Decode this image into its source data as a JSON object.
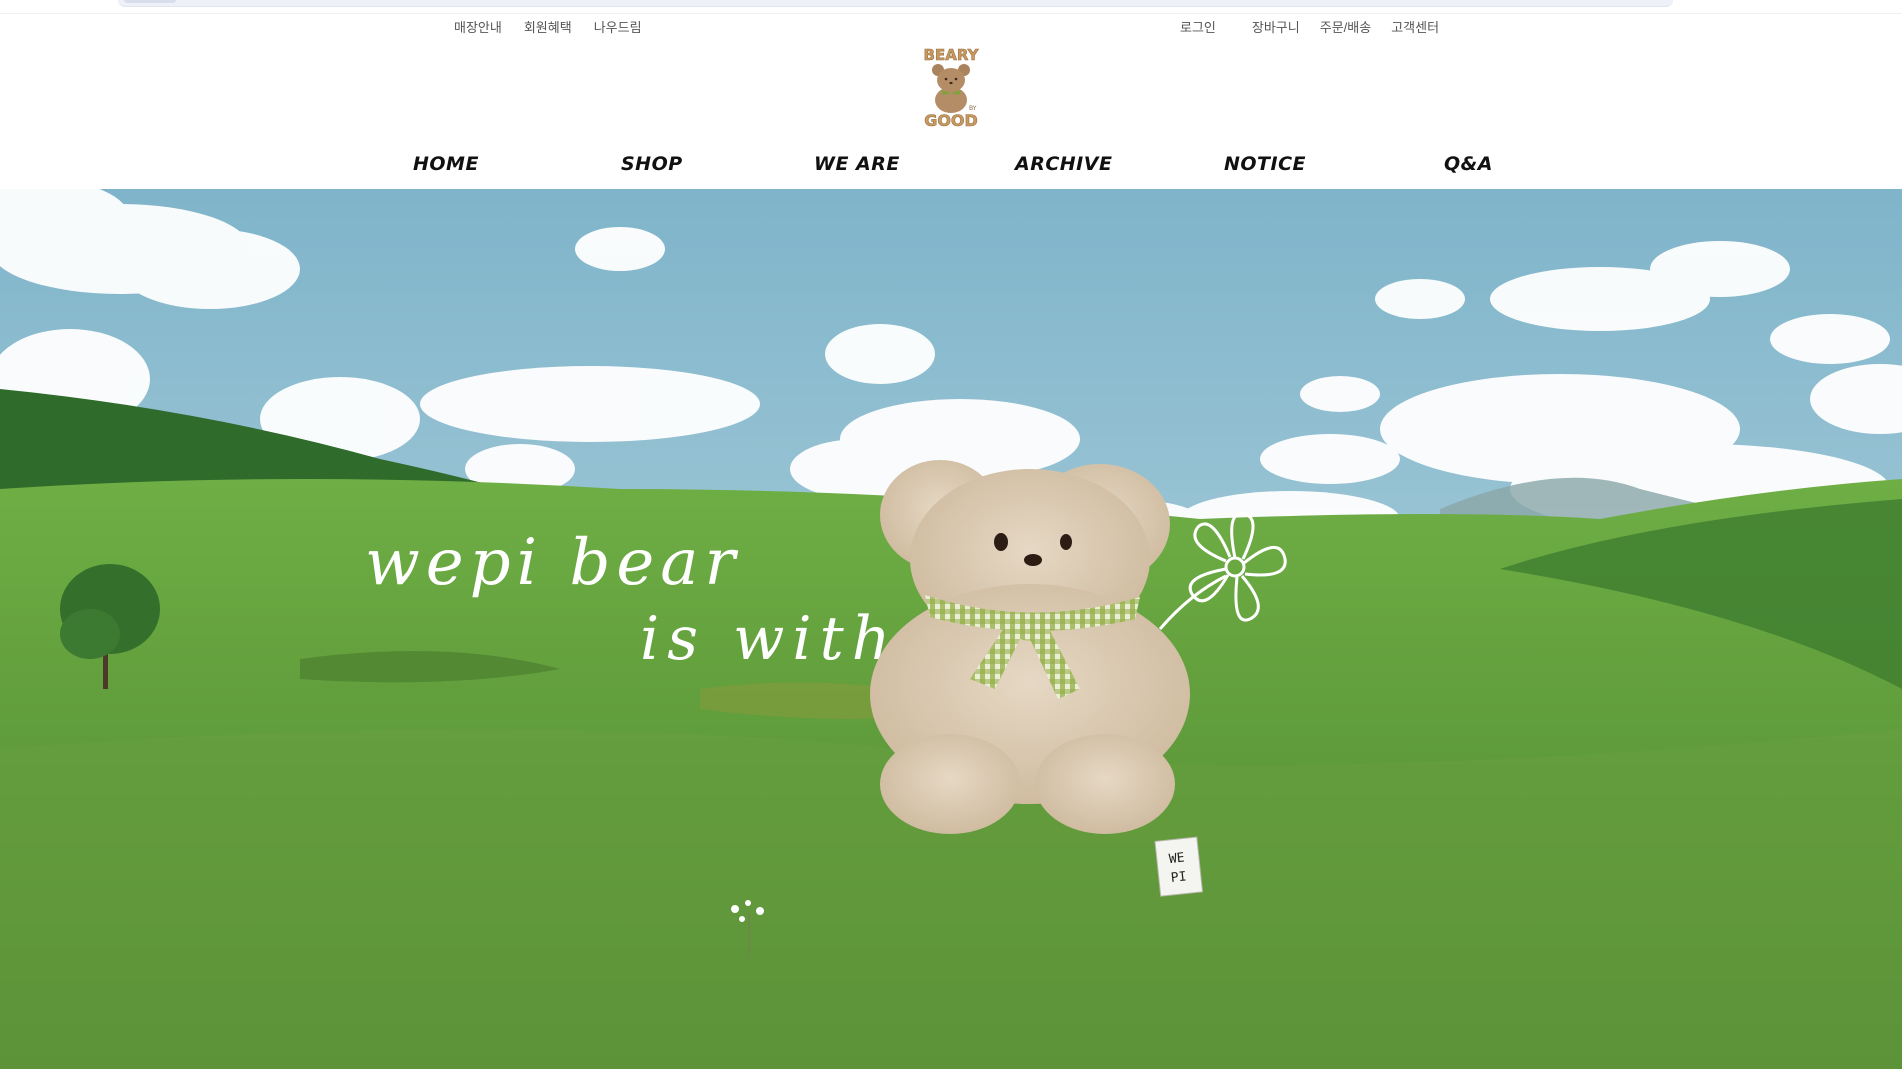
{
  "util_left": [
    "매장안내",
    "회원혜택",
    "나우드림"
  ],
  "util_right": [
    "로그인",
    "장바구니",
    "주문/배송",
    "고객센터"
  ],
  "logo": {
    "top": "BEARY",
    "bottom": "GOOD",
    "small": "BY"
  },
  "nav": [
    "HOME",
    "SHOP",
    "WE ARE",
    "ARCHIVE",
    "NOTICE",
    "Q&A"
  ],
  "hero": {
    "line1": "wepi bear",
    "line2": "is with u",
    "tag_line1": "WE",
    "tag_line2": "PI"
  },
  "colors": {
    "sky": "#8dbcd0",
    "grass": "#5f9a3e",
    "bear": "#d8c7b0",
    "scarf": "#8aa63a"
  }
}
